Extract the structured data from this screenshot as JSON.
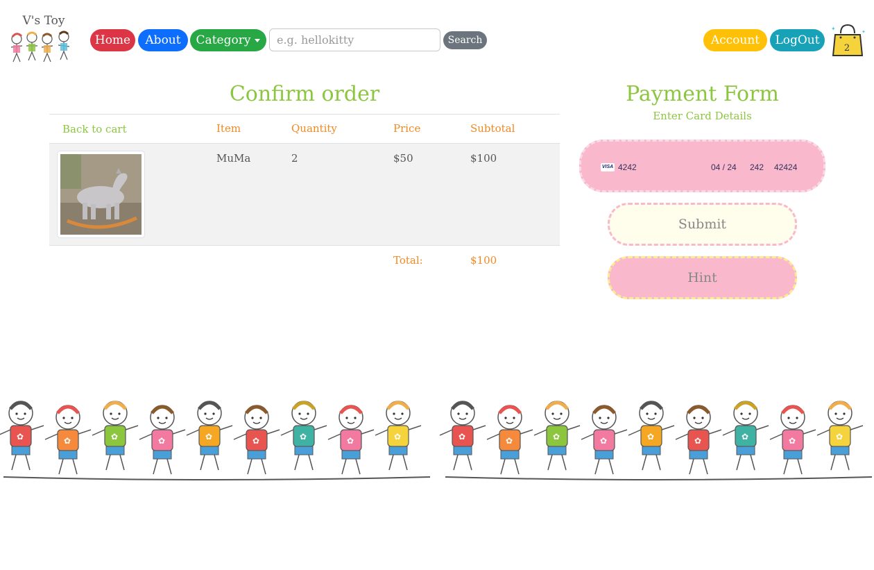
{
  "brand": {
    "name": "V's Toy"
  },
  "nav": {
    "home": "Home",
    "about": "About",
    "category": "Category",
    "search_placeholder": "e.g. hellokitty",
    "search": "Search",
    "account": "Account",
    "logout": "LogOut",
    "cart_count": "2"
  },
  "order": {
    "title": "Confirm order",
    "back_link": "Back to cart",
    "headers": {
      "item": "Item",
      "quantity": "Quantity",
      "price": "Price",
      "subtotal": "Subtotal"
    },
    "rows": [
      {
        "item": "MuMa",
        "quantity": "2",
        "price": "$50",
        "subtotal": "$100"
      }
    ],
    "total_label": "Total:",
    "total_value": "$100"
  },
  "payment": {
    "title": "Payment Form",
    "subtitle": "Enter Card Details",
    "card_brand": "VISA",
    "card_number": "4242",
    "expiry": "04 / 24",
    "cvc": "242",
    "zip": "42424",
    "submit": "Submit",
    "hint": "Hint"
  },
  "colors": {
    "title_green": "#8cc63f",
    "header_orange": "#f08a24",
    "card_pink": "#f9b8cc",
    "submit_cream": "#fffdeb"
  }
}
